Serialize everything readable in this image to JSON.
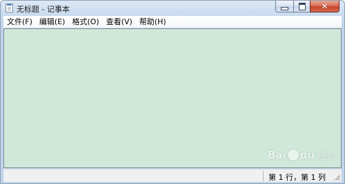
{
  "window": {
    "title": "无标题 - 记事本",
    "app_icon": "notepad-icon",
    "buttons": {
      "minimize_icon": "minimize-icon",
      "maximize_icon": "maximize-icon",
      "close_icon": "close-icon",
      "close_glyph": "✕"
    }
  },
  "menu": {
    "items": [
      {
        "label": "文件(F)"
      },
      {
        "label": "编辑(E)"
      },
      {
        "label": "格式(O)"
      },
      {
        "label": "查看(V)"
      },
      {
        "label": "帮助(H)"
      }
    ]
  },
  "editor": {
    "content": "",
    "background": "#cfe8da"
  },
  "statusbar": {
    "position": "第 1 行，第 1 列"
  },
  "watermark": {
    "text_bai": "Bai",
    "text_du": "du",
    "text_jingyan": "经验"
  },
  "colors": {
    "close_button": "#c7442b",
    "frame": "#bfd3ea"
  }
}
